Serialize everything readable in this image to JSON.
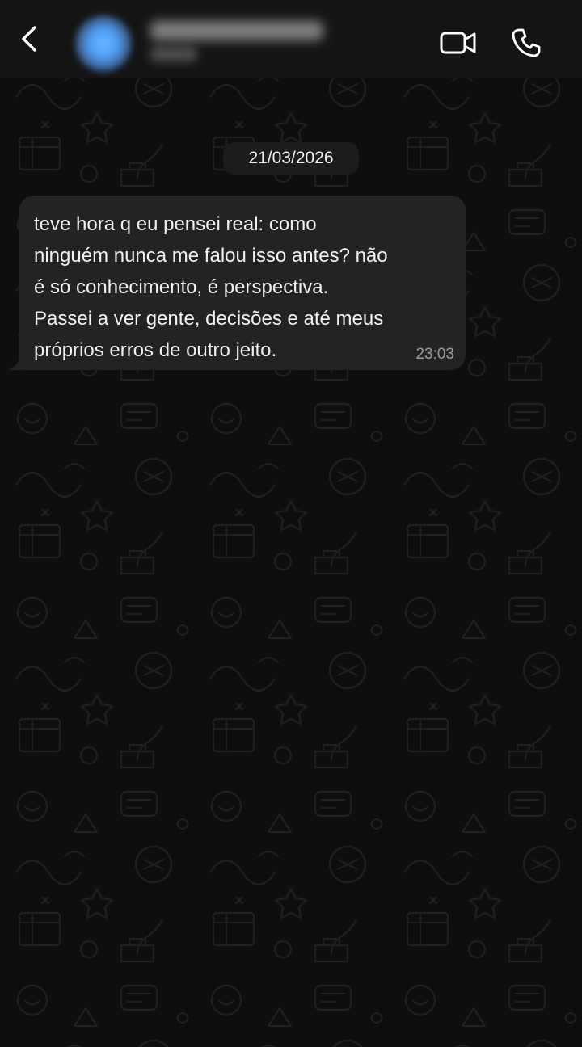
{
  "header": {
    "back_icon": "chevron-left-icon",
    "contact_name": "••••••••••••",
    "contact_status": "•••••",
    "video_icon": "video-camera-icon",
    "call_icon": "phone-icon"
  },
  "chat": {
    "date_label": "21/03/2026",
    "messages": [
      {
        "direction": "incoming",
        "text": "teve hora q eu pensei real: como\nninguém nunca me falou isso antes? não\né só conhecimento, é perspectiva.\nPassei a ver gente, decisões e até meus\npróprios erros de outro jeito.",
        "time": "23:03"
      }
    ]
  },
  "colors": {
    "header_bg": "#141414",
    "chat_bg": "#0e0e0e",
    "bubble_bg": "#232323",
    "icon_color": "#ffffff",
    "doodle_color": "#1d1d1d"
  }
}
